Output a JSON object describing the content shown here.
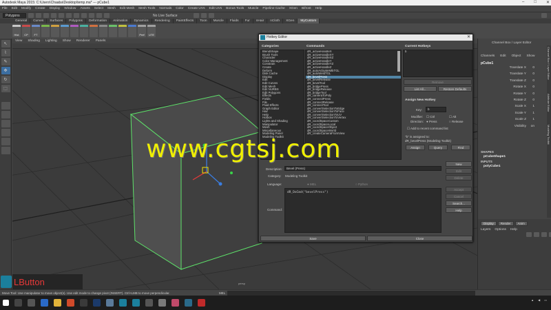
{
  "window": {
    "title": "Autodesk Maya 2015: C:\\Users\\Chaaba\\Desktop\\temp.ma* --- pCube1"
  },
  "menu": [
    "File",
    "Edit",
    "Modify",
    "Create",
    "Display",
    "Window",
    "Assets",
    "Select",
    "Mesh",
    "Edit Mesh",
    "Mesh Tools",
    "Normals",
    "Color",
    "Create UVs",
    "Edit UVs",
    "Bonus Tools",
    "Muscle",
    "Pipeline Cache",
    "XGen",
    "Bifrost",
    "Help"
  ],
  "status": {
    "mode": "Polygons",
    "live": "No Live Surface"
  },
  "shelf_tabs": [
    "General",
    "Curves",
    "Surfaces",
    "Polygons",
    "Deformation",
    "Animation",
    "Dynamics",
    "Rendering",
    "PaintEffects",
    "Toon",
    "Muscle",
    "Fluids",
    "Fur",
    "nHair",
    "nCloth",
    "XGen",
    "MyCustom"
  ],
  "shelf_items": [
    "Hist",
    "CP",
    "FT",
    "",
    "",
    "",
    "",
    "",
    "",
    "",
    "",
    "",
    "",
    "Pref",
    "UTE"
  ],
  "viewport": {
    "menu": [
      "View",
      "Shading",
      "Lighting",
      "Show",
      "Renderer",
      "Panels"
    ],
    "camera": "persp"
  },
  "lbutton": "LButton",
  "helpline": "Move Tool: Use manipulator to move object(s). Use edit mode to change pivot (INSERT). Ctrl+LMB to move perpendicular.",
  "mel_label": "MEL",
  "hotkey": {
    "title": "Hotkey Editor",
    "categories_header": "Categories",
    "commands_header": "Commands",
    "current_header": "Current Hotkeys",
    "current_value": "b",
    "categories": [
      "BlendShape",
      "Brush Tools",
      "Character",
      "Color Management",
      "Constrain",
      "Create",
      "Deform",
      "Disk Cache",
      "Display",
      "Edit",
      "Edit Curves",
      "Edit Mesh",
      "Edit NURBS",
      "Edit Polygons",
      "Effects",
      "Fields",
      "File",
      "Fluid Effects",
      "Graph Editor",
      "Hair",
      "Help",
      "Hotbox",
      "Lights and Shading",
      "Manipulator",
      "Mesh",
      "Miscellaneous",
      "Modeling Panel",
      "Modeling Toolkit"
    ],
    "commands": [
      "dR_activeHandleX",
      "dR_activeHandleXY",
      "dR_activeHandleXZ",
      "dR_activeHandleY",
      "dR_activeHandleYZ",
      "dR_activeHandleZ",
      "dR_autoActivateMtkTGL",
      "dR_autoWeldTGL",
      "dR_bevelPress",
      "dR_bevelRelease",
      "dR_bevelTool",
      "dR_bridgePress",
      "dR_bridgeRelease",
      "dR_bridgeTool",
      "dR_cameraToPoly",
      "dR_connectPress",
      "dR_connectRelease",
      "dR_connectTool",
      "dR_convertSelectionToEdge",
      "dR_convertSelectionToFace",
      "dR_convertSelectionToUV",
      "dR_convertSelectionToVertex",
      "dR_coordSpaceCustom",
      "dR_coordSpaceLocal",
      "dR_coordSpaceObject",
      "dR_coordSpaceWorld",
      "dR_createCameraFromView"
    ],
    "selected_index": 8,
    "remove_label": "Remove",
    "list_all_label": "List All...",
    "restore_label": "Restore Defaults",
    "assign_header": "Assign New Hotkey",
    "key_label": "Key:",
    "key_value": "b",
    "modifier_label": "Modifier:",
    "ctrl_label": "Ctrl",
    "alt_label": "Alt",
    "direction_label": "Direction:",
    "press_label": "Press",
    "release_label": "Release",
    "recent_label": "Add to recent command list",
    "assigned_label": "\"b\" is assigned to:",
    "assigned_value": "dR_bevelPress (Modeling Toolkit)",
    "assign_btn": "Assign",
    "query_btn": "Query",
    "find_btn": "Find",
    "description_label": "Description:",
    "description_value": "Bevel (Press)",
    "category_label": "Category:",
    "category_value": "Modeling Toolkit",
    "language_label": "Language:",
    "mel_radio": "MEL",
    "python_radio": "Python",
    "command_label": "Command:",
    "command_value": "dR_DoCmd(\"bevelPress\")",
    "side_buttons": [
      "New",
      "Edit",
      "Delete",
      "Accept",
      "Cancel",
      "Search...",
      "Help"
    ],
    "save_btn": "Save",
    "close_btn": "Close"
  },
  "channel_box": {
    "header": "Channel Box / Layer Editor",
    "menu": [
      "Channels",
      "Edit",
      "Object",
      "Show"
    ],
    "object": "pCube1",
    "attrs": [
      "Translate X",
      "Translate Y",
      "Translate Z",
      "Rotate X",
      "Rotate Y",
      "Rotate Z",
      "Scale X",
      "Scale Y",
      "Scale Z",
      "Visibility"
    ],
    "values": [
      "0",
      "0",
      "0",
      "0",
      "0",
      "0",
      "1",
      "1",
      "1",
      "on"
    ],
    "shapes_label": "SHAPES",
    "shape_name": "pCubeShape1",
    "inputs_label": "INPUTS",
    "input_name": "polyCube1"
  },
  "layer_panel": {
    "tabs": [
      "Display",
      "Render",
      "Anim"
    ],
    "menu": [
      "Layers",
      "Options",
      "Help"
    ]
  },
  "side_tabs": [
    "Channel Box / Layer Editor",
    "Attribute Editor",
    "Modeling Toolkit"
  ],
  "watermark": "www.cgtsj.com"
}
